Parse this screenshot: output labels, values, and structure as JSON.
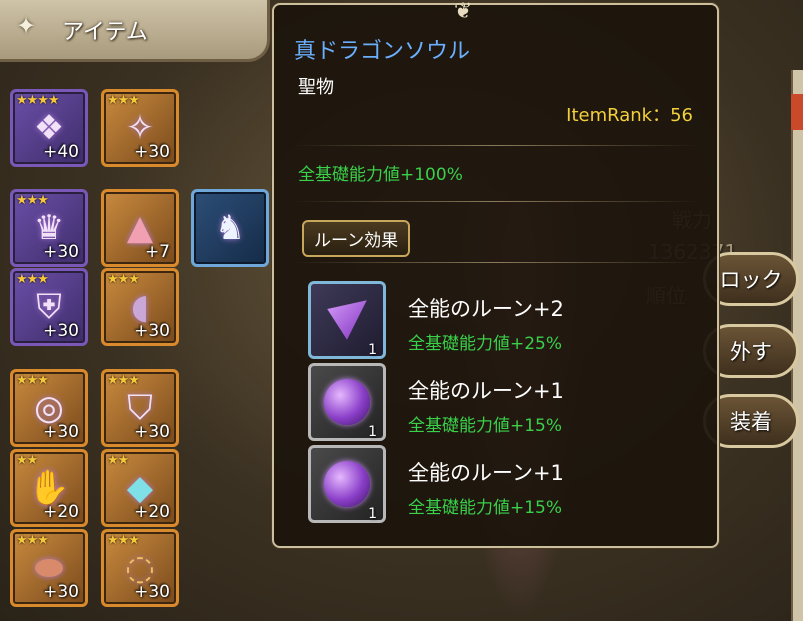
{
  "header": {
    "title": "アイテム",
    "icon": "sparkle-icon"
  },
  "inventory": {
    "slots": [
      {
        "stars": "★★★★",
        "plus": "+40",
        "rarity": "purple",
        "icon": "wing-headgear"
      },
      {
        "stars": "★★★",
        "plus": "+30",
        "rarity": "orange",
        "icon": "orb-staff"
      },
      {
        "stars": "★★★",
        "plus": "+30",
        "rarity": "purple",
        "icon": "crown-helm"
      },
      {
        "stars": "",
        "plus": "+7",
        "rarity": "orange",
        "icon": "pink-hat"
      },
      {
        "stars": "",
        "plus": "",
        "rarity": "blue",
        "icon": "dragon-soul"
      },
      {
        "stars": "★★★",
        "plus": "+30",
        "rarity": "purple",
        "icon": "armor"
      },
      {
        "stars": "★★★",
        "plus": "+30",
        "rarity": "orange",
        "icon": "cloak"
      },
      {
        "stars": "★★★",
        "plus": "+30",
        "rarity": "orange",
        "icon": "ring"
      },
      {
        "stars": "★★★",
        "plus": "+30",
        "rarity": "orange",
        "icon": "robe"
      },
      {
        "stars": "★★",
        "plus": "+20",
        "rarity": "orange",
        "icon": "gauntlet"
      },
      {
        "stars": "★★",
        "plus": "+20",
        "rarity": "orange",
        "icon": "pendant"
      },
      {
        "stars": "★★★",
        "plus": "+30",
        "rarity": "orange",
        "icon": "boots"
      },
      {
        "stars": "★★★",
        "plus": "+30",
        "rarity": "orange",
        "icon": "bracelet"
      }
    ]
  },
  "background": {
    "battle_label": "戦力",
    "battle_value": "1362371",
    "rank_label": "順位"
  },
  "popup": {
    "item_name": "真ドラゴンソウル",
    "category": "聖物",
    "rank": "ItemRank：56",
    "base_stat": "全基礎能力値+100%",
    "rune_section_label": "ルーン効果",
    "runes": [
      {
        "name": "全能のルーン+2",
        "effect": "全基礎能力値+25%",
        "qty": "1",
        "shape": "triangle"
      },
      {
        "name": "全能のルーン+1",
        "effect": "全基礎能力値+15%",
        "qty": "1",
        "shape": "orb"
      },
      {
        "name": "全能のルーン+1",
        "effect": "全基礎能力値+15%",
        "qty": "1",
        "shape": "orb"
      }
    ]
  },
  "actions": {
    "lock_label": "ロック",
    "remove_label": "外す",
    "equip_label": "装着"
  },
  "colors": {
    "item_name": "#6ab0ff",
    "rank": "#f2cf3c",
    "stat_green": "#39d04a"
  }
}
